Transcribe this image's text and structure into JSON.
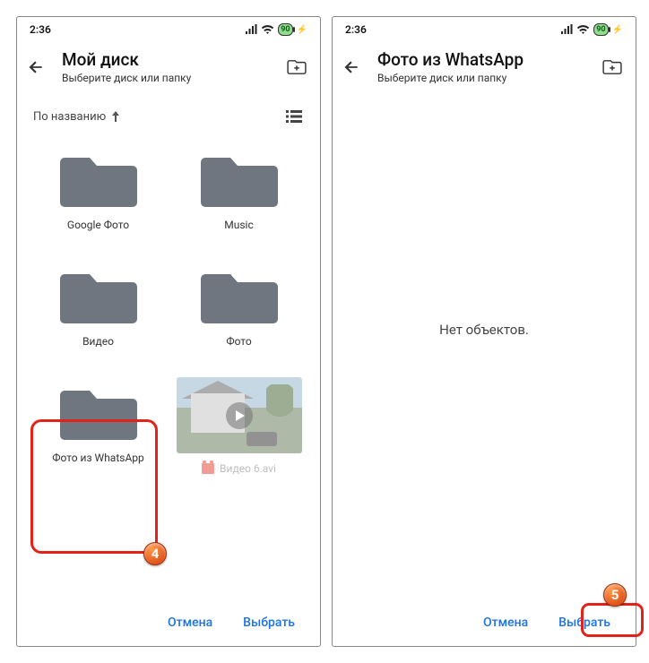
{
  "status": {
    "time": "2:36",
    "battery_pct": "90"
  },
  "left": {
    "header": {
      "title": "Мой диск",
      "subtitle": "Выберите диск или папку"
    },
    "sort": {
      "label": "По названию"
    },
    "folders": [
      {
        "label": "Google Фото"
      },
      {
        "label": "Music"
      },
      {
        "label": "Видео"
      },
      {
        "label": "Фото"
      },
      {
        "label": "Фото из WhatsApp"
      }
    ],
    "video": {
      "label": "Видео 6.avi"
    },
    "footer": {
      "cancel": "Отмена",
      "select": "Выбрать"
    }
  },
  "right": {
    "header": {
      "title": "Фото из WhatsApp",
      "subtitle": "Выберите диск или папку"
    },
    "empty_text": "Нет объектов.",
    "footer": {
      "cancel": "Отмена",
      "select": "Выбрать"
    }
  },
  "badges": {
    "b4": "4",
    "b5": "5"
  }
}
